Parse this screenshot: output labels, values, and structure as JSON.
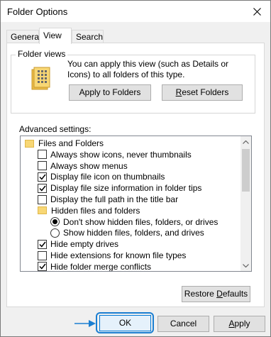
{
  "window": {
    "title": "Folder Options"
  },
  "tabs": [
    {
      "label": "General"
    },
    {
      "label": "View"
    },
    {
      "label": "Search"
    }
  ],
  "folder_views": {
    "legend": "Folder views",
    "description": "You can apply this view (such as Details or Icons) to all folders of this type.",
    "apply_button": "Apply to Folders",
    "reset_button_prefix": "",
    "reset_button_mnemonic": "R",
    "reset_button_rest": "eset Folders"
  },
  "advanced": {
    "label": "Advanced settings:",
    "items": [
      {
        "type": "folder",
        "label": "Files and Folders"
      },
      {
        "type": "checkbox",
        "label": "Always show icons, never thumbnails",
        "checked": false
      },
      {
        "type": "checkbox",
        "label": "Always show menus",
        "checked": false
      },
      {
        "type": "checkbox",
        "label": "Display file icon on thumbnails",
        "checked": true
      },
      {
        "type": "checkbox",
        "label": "Display file size information in folder tips",
        "checked": true
      },
      {
        "type": "checkbox",
        "label": "Display the full path in the title bar",
        "checked": false
      },
      {
        "type": "folder",
        "label": "Hidden files and folders"
      },
      {
        "type": "radio",
        "label": "Don't show hidden files, folders, or drives",
        "checked": true
      },
      {
        "type": "radio",
        "label": "Show hidden files, folders, and drives",
        "checked": false
      },
      {
        "type": "checkbox",
        "label": "Hide empty drives",
        "checked": true
      },
      {
        "type": "checkbox",
        "label": "Hide extensions for known file types",
        "checked": false
      },
      {
        "type": "checkbox",
        "label": "Hide folder merge conflicts",
        "checked": true
      }
    ]
  },
  "buttons": {
    "restore_prefix": "Restore ",
    "restore_mnemonic": "D",
    "restore_rest": "efaults",
    "ok": "OK",
    "cancel": "Cancel",
    "apply_mnemonic": "A",
    "apply_rest": "pply"
  },
  "colors": {
    "focus_ring": "#1c7fd1",
    "folder": "#f8d775"
  }
}
